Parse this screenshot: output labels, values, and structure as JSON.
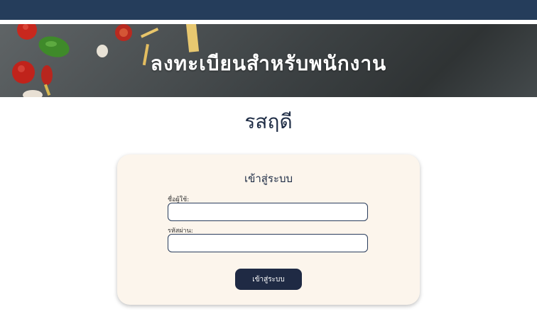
{
  "header": {
    "banner_title": "ลงทะเบียนสำหรับพนักงาน"
  },
  "greeting": "รสฤดี",
  "login": {
    "title": "เข้าสู่ระบบ",
    "username_label": "ชื่อผู้ใช้:",
    "username_value": "",
    "password_label": "รหัสผ่าน:",
    "password_value": "",
    "submit_label": "เข้าสู่ระบบ"
  },
  "colors": {
    "topbar": "#253d5b",
    "card_background": "#fcf5ec",
    "button": "#1f2a44",
    "heading_text": "#1e2c45"
  }
}
